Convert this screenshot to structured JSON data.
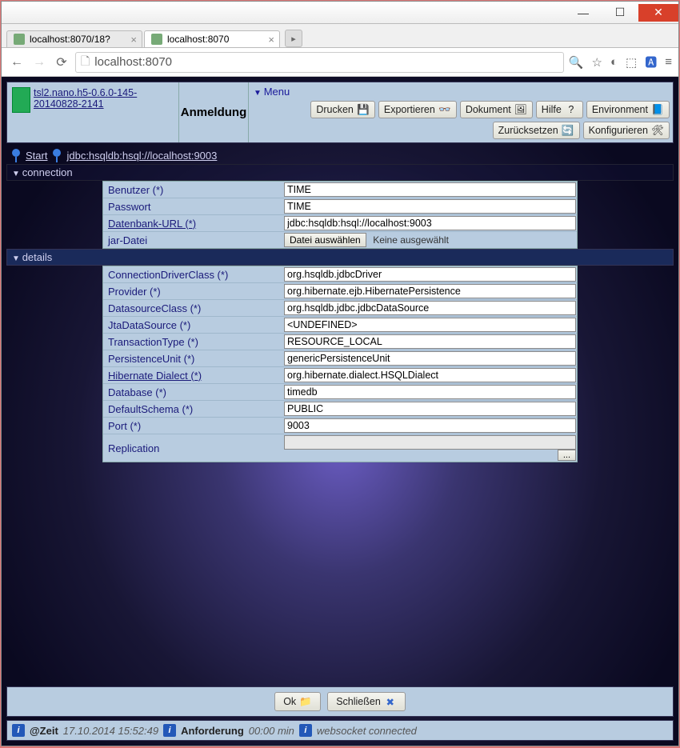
{
  "window": {
    "tabs": [
      {
        "label": "localhost:8070/18?",
        "active": false
      },
      {
        "label": "localhost:8070",
        "active": true
      }
    ],
    "url": "localhost:8070"
  },
  "header": {
    "app_link": "tsl2.nano.h5-0.6.0-145-20140828-2141",
    "title": "Anmeldung",
    "menu_label": "Menu",
    "buttons": {
      "print": "Drucken",
      "export": "Exportieren",
      "document": "Dokument",
      "help": "Hilfe",
      "environment": "Environment",
      "reset": "Zurücksetzen",
      "configure": "Konfigurieren"
    }
  },
  "breadcrumb": {
    "start": "Start",
    "path": "jdbc:hsqldb:hsql://localhost:9003"
  },
  "sections": {
    "connection": "connection",
    "details": "details"
  },
  "connection": {
    "user_label": "Benutzer (*)",
    "user_value": "TIME",
    "password_label": "Passwort",
    "password_value": "TIME",
    "dburl_label": "Datenbank-URL (*)",
    "dburl_value": "jdbc:hsqldb:hsql://localhost:9003",
    "jar_label": "jar-Datei",
    "file_button": "Datei auswählen",
    "file_status": "Keine ausgewählt"
  },
  "details": {
    "driver_label": "ConnectionDriverClass (*)",
    "driver_value": "org.hsqldb.jdbcDriver",
    "provider_label": "Provider (*)",
    "provider_value": "org.hibernate.ejb.HibernatePersistence",
    "dsclass_label": "DatasourceClass (*)",
    "dsclass_value": "org.hsqldb.jdbc.jdbcDataSource",
    "jta_label": "JtaDataSource (*)",
    "jta_value": "<UNDEFINED>",
    "txn_label": "TransactionType (*)",
    "txn_value": "RESOURCE_LOCAL",
    "pu_label": "PersistenceUnit (*)",
    "pu_value": "genericPersistenceUnit",
    "dialect_label": "Hibernate Dialect (*)",
    "dialect_value": "org.hibernate.dialect.HSQLDialect",
    "db_label": "Database (*)",
    "db_value": "timedb",
    "schema_label": "DefaultSchema (*)",
    "schema_value": "PUBLIC",
    "port_label": "Port (*)",
    "port_value": "9003",
    "repl_label": "Replication",
    "repl_value": ""
  },
  "footer": {
    "ok": "Ok",
    "close": "Schließen"
  },
  "status": {
    "time_label": "@Zeit",
    "time_value": "17.10.2014 15:52:49",
    "req_label": "Anforderung",
    "req_value": "00:00 min",
    "ws": "websocket connected"
  }
}
